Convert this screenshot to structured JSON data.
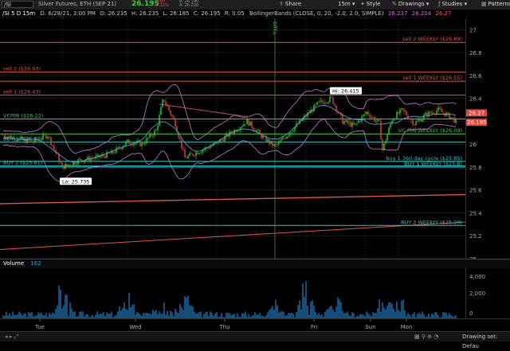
{
  "toolbar": {
    "symbol_input": "/SI",
    "description": "Silver Futures, ETH (SEP 21)",
    "last_price": "26.195",
    "net_change": "-.090",
    "pct_change": "-0.22%",
    "bid": "B: 26.190",
    "ask": "A: 26.200",
    "share_label": "Share",
    "timeframe_label": "15m",
    "style_label": "Style",
    "drawings_label": "Drawings",
    "studies_label": "Studies",
    "patterns_label": "Patterns"
  },
  "infobar": {
    "title": "/SI 5 D 15m",
    "date": "D: 6/28/21, 3:00 PM",
    "open": "O: 26.235",
    "high": "H: 26.235",
    "low": "L: 26.185",
    "close": "C: 26.195",
    "range": "R: 0.05",
    "study": "BollingerBands (CLOSE, 0, 20, -2.0, 2.0, SIMPLE)",
    "bb_upper": "26.237",
    "bb_mid": "26.204",
    "bb_lower": "26.27"
  },
  "chart_data": {
    "type": "candlestick",
    "symbol": "/SI",
    "timeframe": "15m",
    "ylim": [
      25.0,
      27.1
    ],
    "y_ticks": [
      "27",
      "26.8",
      "26.6",
      "26.4",
      "26.2",
      "26",
      "25.8",
      "25.6",
      "25.4",
      "25.2",
      "25"
    ],
    "x_labels": [
      "Tue",
      "Wed",
      "Thu",
      "Fri",
      "Sun",
      "Mon"
    ],
    "highs_lows": [
      {
        "label": "Hi: 26.415",
        "value": 26.415
      },
      {
        "label": "Lo: 25.735",
        "value": 25.735
      }
    ],
    "levels": [
      {
        "label": "sell 2 WEEKLY ($26.89)",
        "value": 26.89,
        "color": "#e0544a"
      },
      {
        "label": "sell 2 ($26.63)",
        "value": 26.63,
        "color": "#e0544a"
      },
      {
        "label": "sell 1 WEEKLY ($26.55)",
        "value": 26.55,
        "color": "#e0544a"
      },
      {
        "label": "sell 1 ($26.43)",
        "value": 26.43,
        "color": "#e0544a"
      },
      {
        "label": "VCPMI ($26.22)",
        "value": 26.22,
        "color": "#3fcf3f"
      },
      {
        "label": "VC PMI WEEKLY ($26.09)",
        "value": 26.09,
        "color": "#3fcf3f"
      },
      {
        "label": "BUY 1 ($26.02)",
        "value": 26.02,
        "color": "#2bc4c4"
      },
      {
        "label": "buy 1 360 day cycle ($25.85)",
        "value": 25.85,
        "color": "#2bc4c4"
      },
      {
        "label": "BUY 1 WEEKLY ($25.8)",
        "value": 25.8,
        "color": "#2bc4c4"
      },
      {
        "label": "BUY 2 ($25.81)",
        "value": 25.81,
        "color": "#2bc4c4"
      },
      {
        "label": "BUY 2 WEEKLY ($25.29)",
        "value": 25.29,
        "color": "#2bc4c4"
      }
    ],
    "current_price": 26.195,
    "upper_band_value": 26.27,
    "volume": {
      "label": "Volume",
      "value": "162",
      "ticks": [
        "4,000",
        "2,000",
        "0"
      ]
    },
    "vertical_marker_label": "GRT.L"
  },
  "price_tags": {
    "upper": "26.27",
    "last": "26.195"
  },
  "status": {
    "drawing_set": "Drawing set: Defau"
  }
}
